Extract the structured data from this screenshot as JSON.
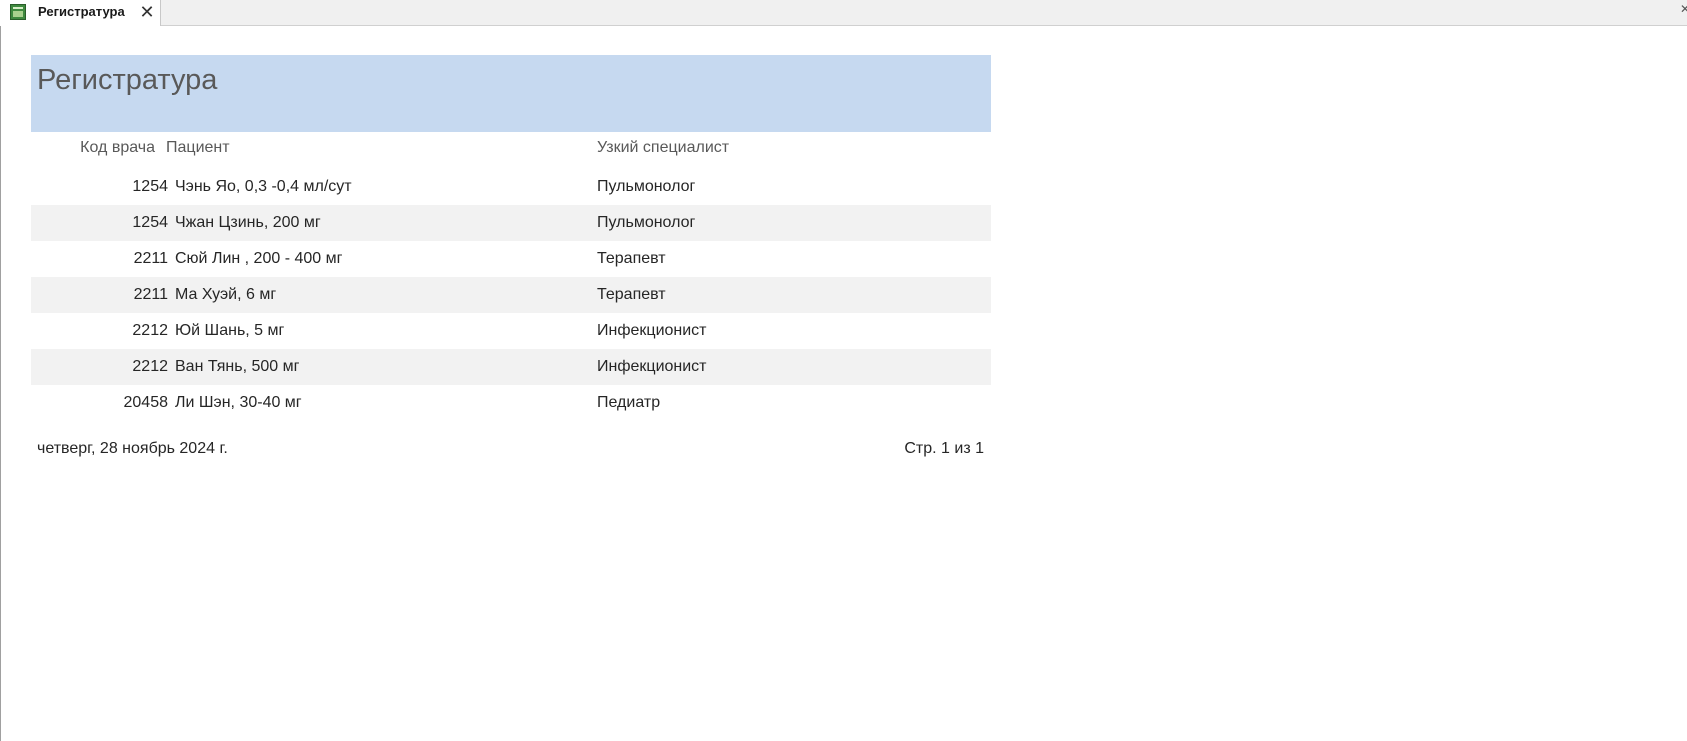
{
  "tab": {
    "title": "Регистратура",
    "close_glyph": "✕"
  },
  "report": {
    "title": "Регистратура",
    "columns": {
      "code": "Код врача",
      "patient": "Пациент",
      "specialist": "Узкий специалист"
    },
    "rows": [
      {
        "code": "1254",
        "patient": "Чэнь Яо, 0,3 -0,4 мл/сут",
        "specialist": "Пульмонолог"
      },
      {
        "code": "1254",
        "patient": "Чжан Цзинь, 200 мг",
        "specialist": "Пульмонолог"
      },
      {
        "code": "2211",
        "patient": "Сюй Лин , 200 - 400 мг",
        "specialist": "Терапевт"
      },
      {
        "code": "2211",
        "patient": "Ма Хуэй, 6 мг",
        "specialist": "Терапевт"
      },
      {
        "code": "2212",
        "patient": "Юй Шань, 5 мг",
        "specialist": "Инфекционист"
      },
      {
        "code": "2212",
        "patient": "Ван Тянь, 500 мг",
        "specialist": "Инфекционист"
      },
      {
        "code": "20458",
        "patient": "Ли Шэн, 30-40 мг",
        "specialist": "Педиатр"
      }
    ],
    "footer": {
      "date": "четверг, 28 ноябрь 2024 г.",
      "page": "Стр. 1 из 1"
    }
  },
  "colors": {
    "header_band": "#c6d9f0",
    "alt_row": "#f2f2f2",
    "icon_green": "#3f8a3f"
  },
  "icons": {
    "tab_icon": "report-icon",
    "close_icon": "close-icon"
  }
}
